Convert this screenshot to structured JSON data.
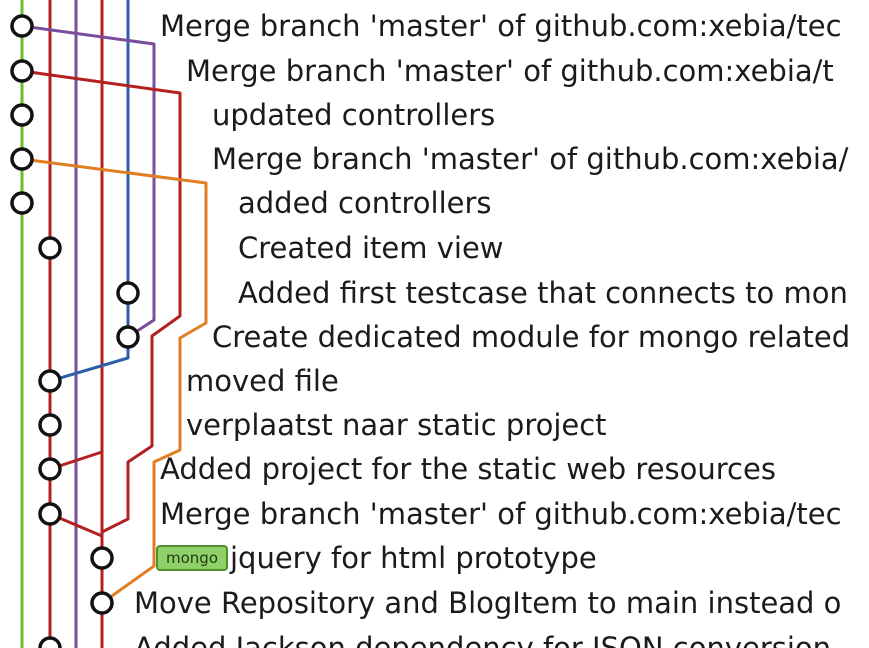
{
  "colors": {
    "green": "#6cbc2e",
    "purple": "#7a4c9c",
    "red": "#b42020",
    "blue": "#2f5ea8",
    "orange": "#e07e22",
    "tag_fill": "#8fd06a"
  },
  "commits": [
    {
      "message": "Merge branch 'master' of github.com:xebia/tec",
      "tag": ""
    },
    {
      "message": "Merge branch 'master' of github.com:xebia/t",
      "tag": ""
    },
    {
      "message": "updated controllers",
      "tag": ""
    },
    {
      "message": "Merge branch 'master' of github.com:xebia/",
      "tag": ""
    },
    {
      "message": "added controllers",
      "tag": ""
    },
    {
      "message": "Created item view",
      "tag": ""
    },
    {
      "message": "Added first testcase that connects to mon",
      "tag": ""
    },
    {
      "message": "Create dedicated module for mongo related",
      "tag": ""
    },
    {
      "message": "moved file",
      "tag": ""
    },
    {
      "message": "verplaatst naar static project",
      "tag": ""
    },
    {
      "message": "Added project for the static web resources",
      "tag": ""
    },
    {
      "message": "Merge branch 'master' of github.com:xebia/tec",
      "tag": ""
    },
    {
      "message": "jquery for html prototype",
      "tag": "mongo"
    },
    {
      "message": "Move Repository and BlogItem to main instead o",
      "tag": ""
    },
    {
      "message": "Added Jackson dependency for JSON conversion",
      "tag": ""
    }
  ]
}
